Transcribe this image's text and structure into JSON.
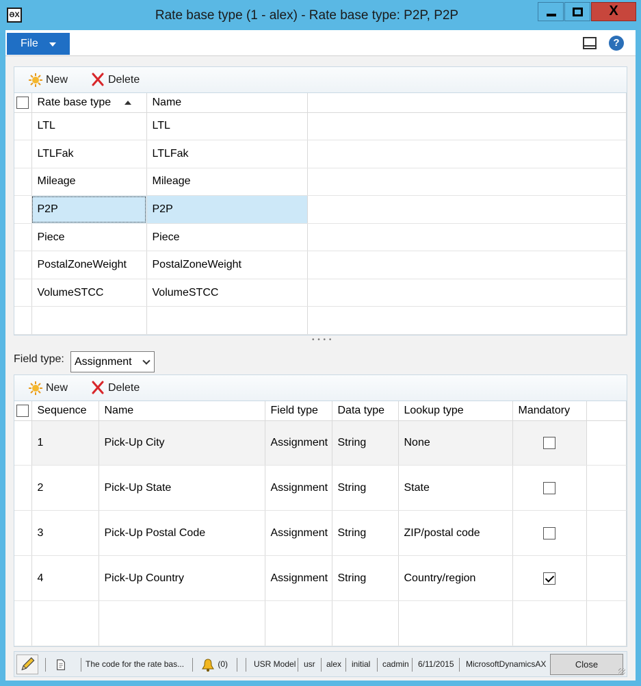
{
  "window": {
    "title": "Rate base type (1 - alex) - Rate base type: P2P, P2P",
    "app_icon_glyph": "ƏX",
    "close_glyph": "X"
  },
  "menubar": {
    "file_label": "File"
  },
  "toolbar": {
    "new_label": "New",
    "delete_label": "Delete"
  },
  "rate_grid": {
    "columns": [
      "Rate base type",
      "Name"
    ],
    "rows": [
      {
        "type": "LTL",
        "name": "LTL"
      },
      {
        "type": "LTLFak",
        "name": "LTLFak"
      },
      {
        "type": "Mileage",
        "name": "Mileage"
      },
      {
        "type": "P2P",
        "name": "P2P"
      },
      {
        "type": "Piece",
        "name": "Piece"
      },
      {
        "type": "PostalZoneWeight",
        "name": "PostalZoneWeight"
      },
      {
        "type": "VolumeSTCC",
        "name": "VolumeSTCC"
      }
    ],
    "selected_index": 3
  },
  "splitter_glyph": "• • • •",
  "field_type": {
    "label": "Field type:",
    "value": "Assignment"
  },
  "field_toolbar": {
    "new_label": "New",
    "delete_label": "Delete"
  },
  "field_grid": {
    "columns": [
      "Sequence",
      "Name",
      "Field type",
      "Data type",
      "Lookup type",
      "Mandatory"
    ],
    "rows": [
      {
        "seq": "1",
        "name": "Pick-Up City",
        "field_type": "Assignment",
        "data_type": "String",
        "lookup": "None",
        "mandatory": false
      },
      {
        "seq": "2",
        "name": "Pick-Up State",
        "field_type": "Assignment",
        "data_type": "String",
        "lookup": "State",
        "mandatory": false
      },
      {
        "seq": "3",
        "name": "Pick-Up Postal Code",
        "field_type": "Assignment",
        "data_type": "String",
        "lookup": "ZIP/postal code",
        "mandatory": false
      },
      {
        "seq": "4",
        "name": "Pick-Up Country",
        "field_type": "Assignment",
        "data_type": "String",
        "lookup": "Country/region",
        "mandatory": true
      }
    ]
  },
  "statusbar": {
    "message": "The code for the rate bas...",
    "notifications": "(0)",
    "model": "USR Model",
    "layer": "usr",
    "user": "alex",
    "partition": "initial",
    "company": "cadmin",
    "date": "6/11/2015",
    "application": "MicrosoftDynamicsAX",
    "close_label": "Close"
  }
}
